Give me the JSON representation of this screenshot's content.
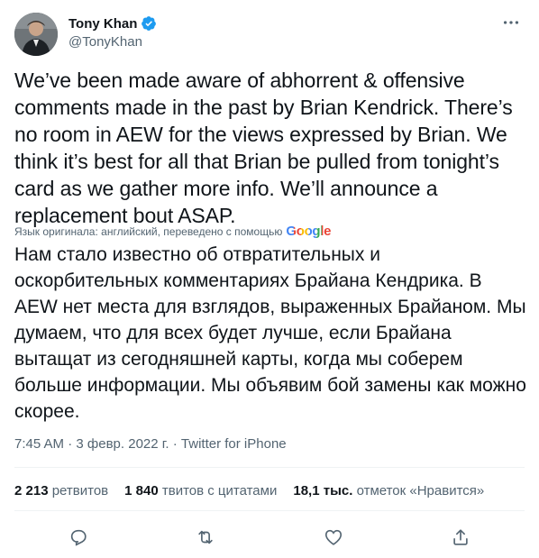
{
  "author": {
    "name": "Tony Khan",
    "handle": "@TonyKhan"
  },
  "tweet": {
    "text": "We’ve been made aware of abhorrent & offensive comments made in the past by Brian Kendrick. There’s no room in AEW for the views expressed by Brian. We think it’s best for all that Brian be pulled from tonight’s card as we gather more info. We’ll announce a replacement bout ASAP.",
    "translation_note": "Язык оригинала: английский, переведено с помощью",
    "translation_provider": "Google",
    "translated_text": "Нам стало известно об отвратительных и оскорбительных комментариях Брайана Кендрика. В AEW нет места для взглядов, выраженных Брайаном. Мы думаем, что для всех будет лучше, если Брайана вытащат из сегодняшней карты, когда мы соберем больше информации. Мы объявим бой замены как можно скорее.",
    "time": "7:45 AM",
    "date": "3 февр. 2022 г.",
    "separator": "·",
    "source": "Twitter for iPhone"
  },
  "stats": {
    "retweets_count": "2 213",
    "retweets_label": "ретвитов",
    "quotes_count": "1 840",
    "quotes_label": "твитов с цитатами",
    "likes_count": "18,1 тыс.",
    "likes_label": "отметок «Нравится»"
  },
  "colors": {
    "verified": "#1d9bf0",
    "secondary_text": "#536471",
    "primary_text": "#0f1419",
    "divider": "#eff3f4"
  },
  "icons": [
    "verified-badge-icon",
    "more-icon",
    "reply-icon",
    "retweet-icon",
    "like-icon",
    "share-icon"
  ]
}
